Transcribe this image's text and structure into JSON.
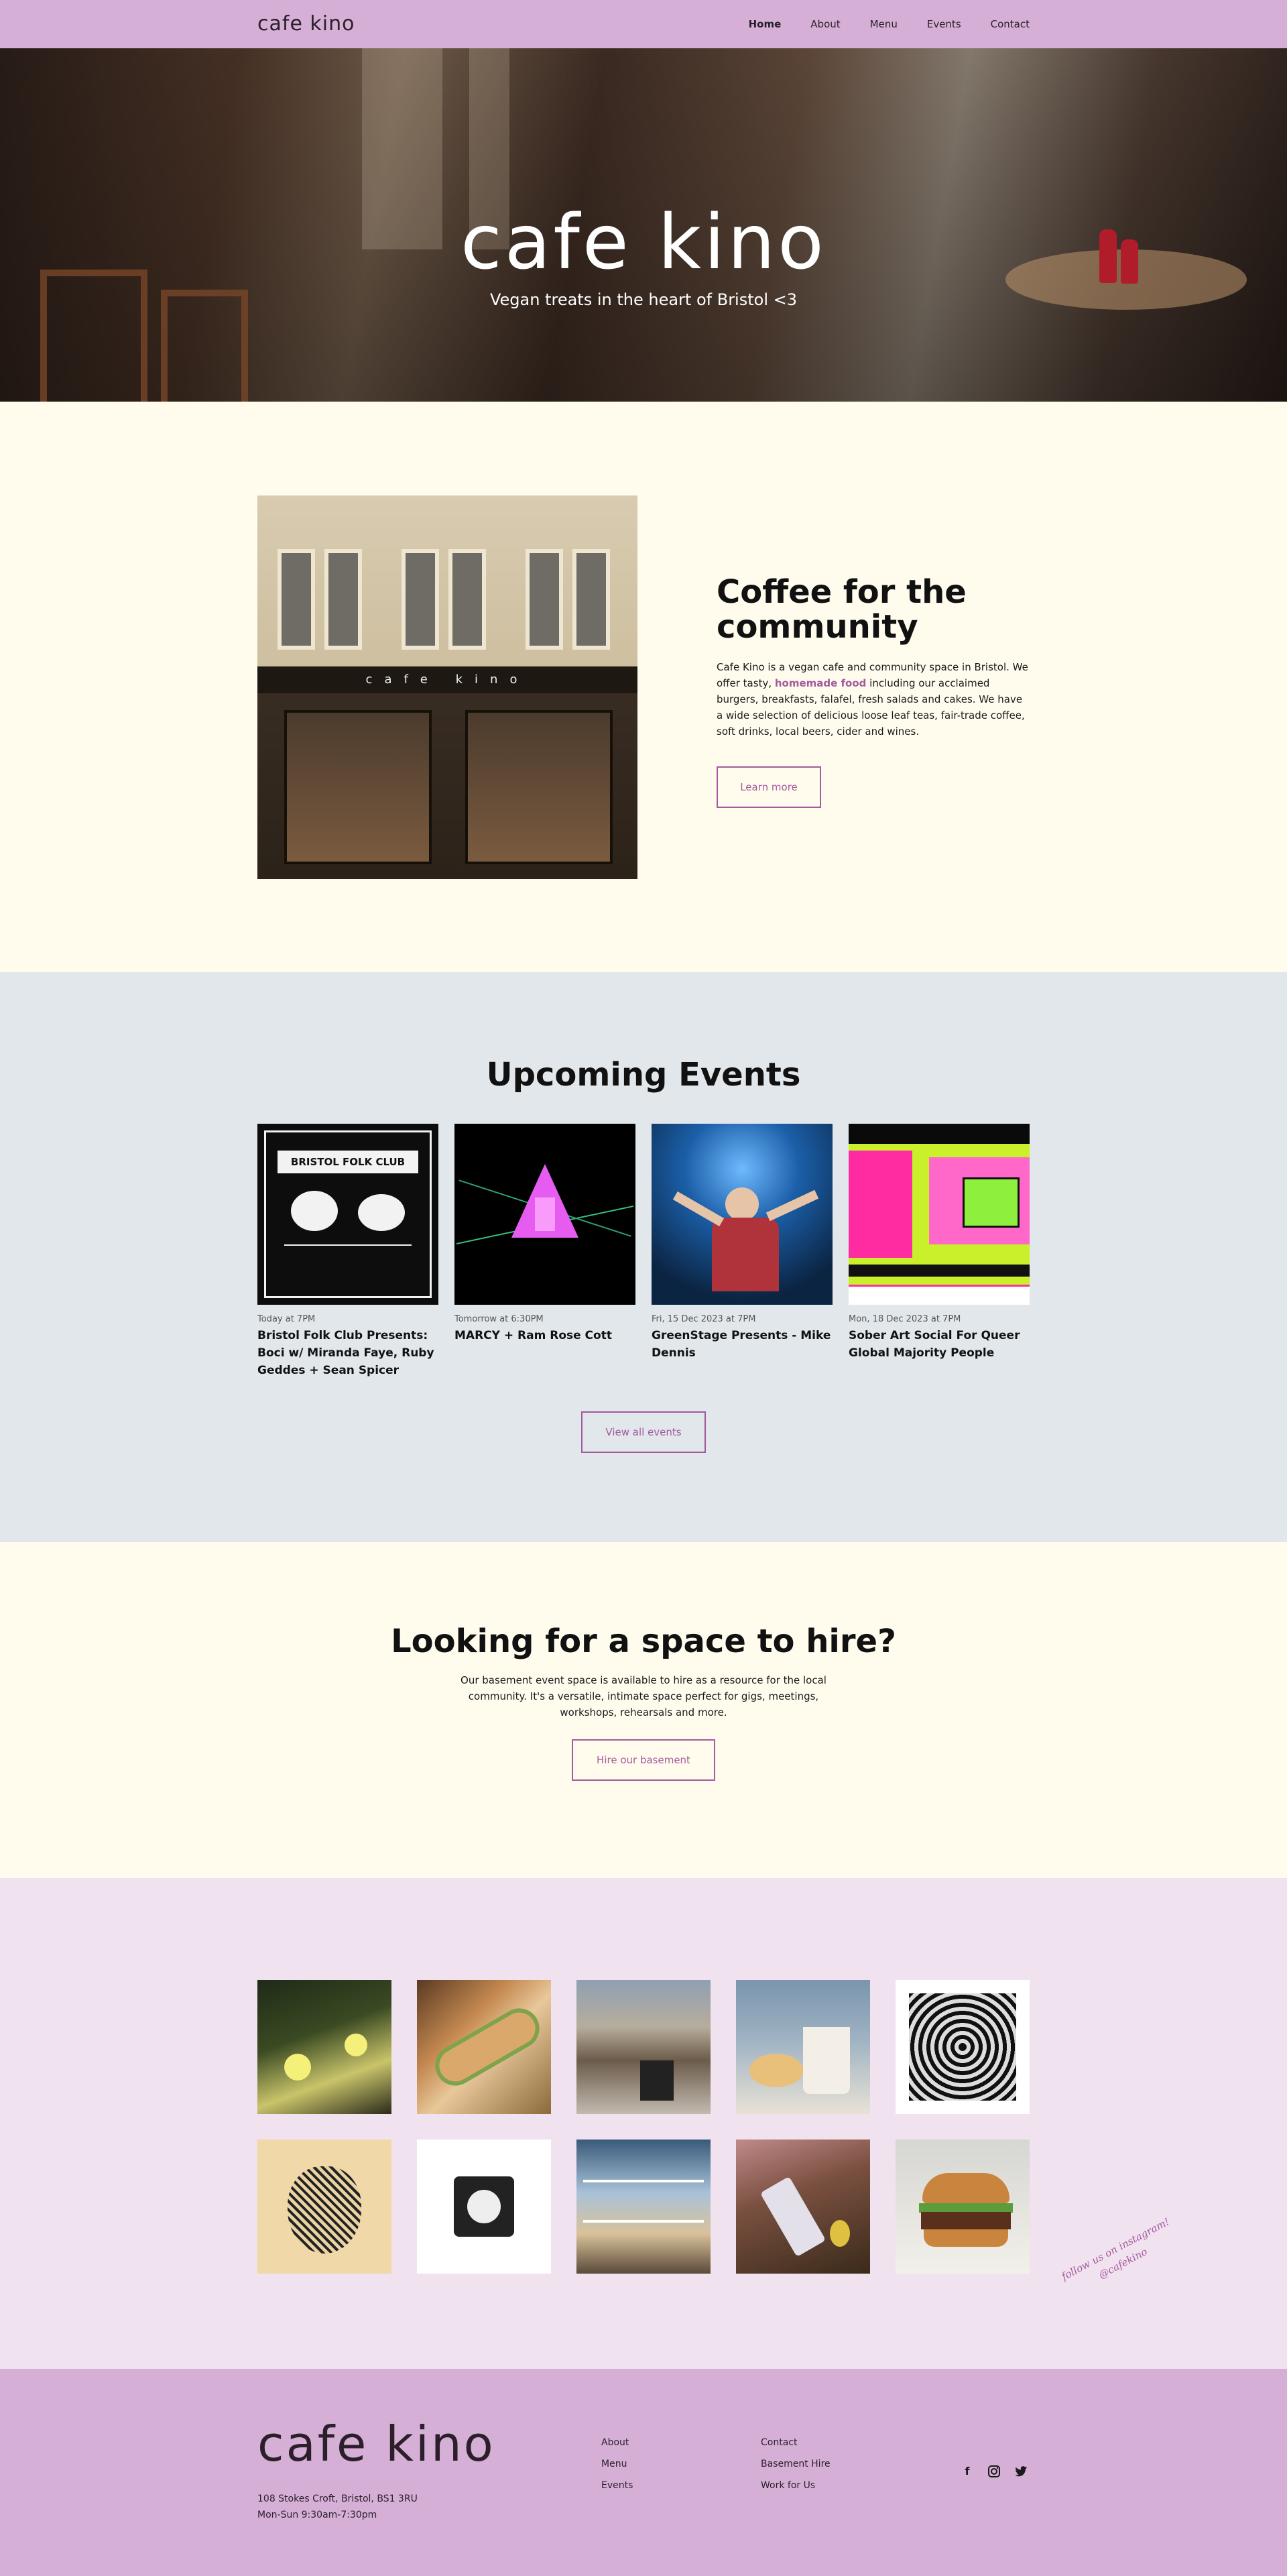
{
  "nav": {
    "logo": "cafe kino",
    "items": [
      {
        "label": "Home",
        "active": true
      },
      {
        "label": "About",
        "active": false
      },
      {
        "label": "Menu",
        "active": false
      },
      {
        "label": "Events",
        "active": false
      },
      {
        "label": "Contact",
        "active": false
      }
    ]
  },
  "hero": {
    "title": "cafe kino",
    "subtitle": "Vegan treats in the heart of Bristol <3"
  },
  "about": {
    "heading": "Coffee for the community",
    "text_before": "Cafe Kino is a vegan cafe and community space in Bristol. We offer tasty, ",
    "link": "homemade food",
    "text_after": " including our acclaimed burgers, breakfasts, falafel, fresh salads and cakes. We have a wide selection of delicious loose leaf teas, fair-trade coffee, soft drinks, local beers, cider and wines.",
    "button": "Learn more",
    "photo_sign": "cafe kino"
  },
  "events": {
    "heading": "Upcoming Events",
    "items": [
      {
        "date": "Today at 7PM",
        "title": "Bristol Folk Club Presents: Boci w/ Miranda Faye, Ruby Geddes + Sean Spicer",
        "poster_text": "BRISTOL FOLK CLUB"
      },
      {
        "date": "Tomorrow at 6:30PM",
        "title": "MARCY + Ram Rose Cott"
      },
      {
        "date": "Fri, 15 Dec 2023 at 7PM",
        "title": "GreenStage Presents - Mike Dennis"
      },
      {
        "date": "Mon, 18 Dec 2023 at 7PM",
        "title": "Sober Art Social For Queer Global Majority People"
      }
    ],
    "button": "View all events"
  },
  "hire": {
    "heading": "Looking for a space to hire?",
    "text": "Our basement event space is available to hire as a resource for the local community. It's a versatile, intimate space perfect for gigs, meetings, workshops, rehearsals and more.",
    "button": "Hire our basement"
  },
  "instagram": {
    "note_line1": "follow us on instagram!",
    "note_line2": "@cafekino"
  },
  "footer": {
    "logo": "cafe kino",
    "address": "108 Stokes Croft, Bristol, BS1 3RU",
    "hours": "Mon-Sun 9:30am-7:30pm",
    "col1": [
      "About",
      "Menu",
      "Events"
    ],
    "col2": [
      "Contact",
      "Basement Hire",
      "Work for Us"
    ],
    "social": [
      "facebook-icon",
      "instagram-icon",
      "twitter-icon"
    ]
  },
  "colors": {
    "nav_bg": "#d5afd6",
    "accent": "#a45a9d",
    "cream": "#fffcee",
    "events_bg": "#e1e7eb",
    "insta_bg": "#f1e2f0"
  }
}
